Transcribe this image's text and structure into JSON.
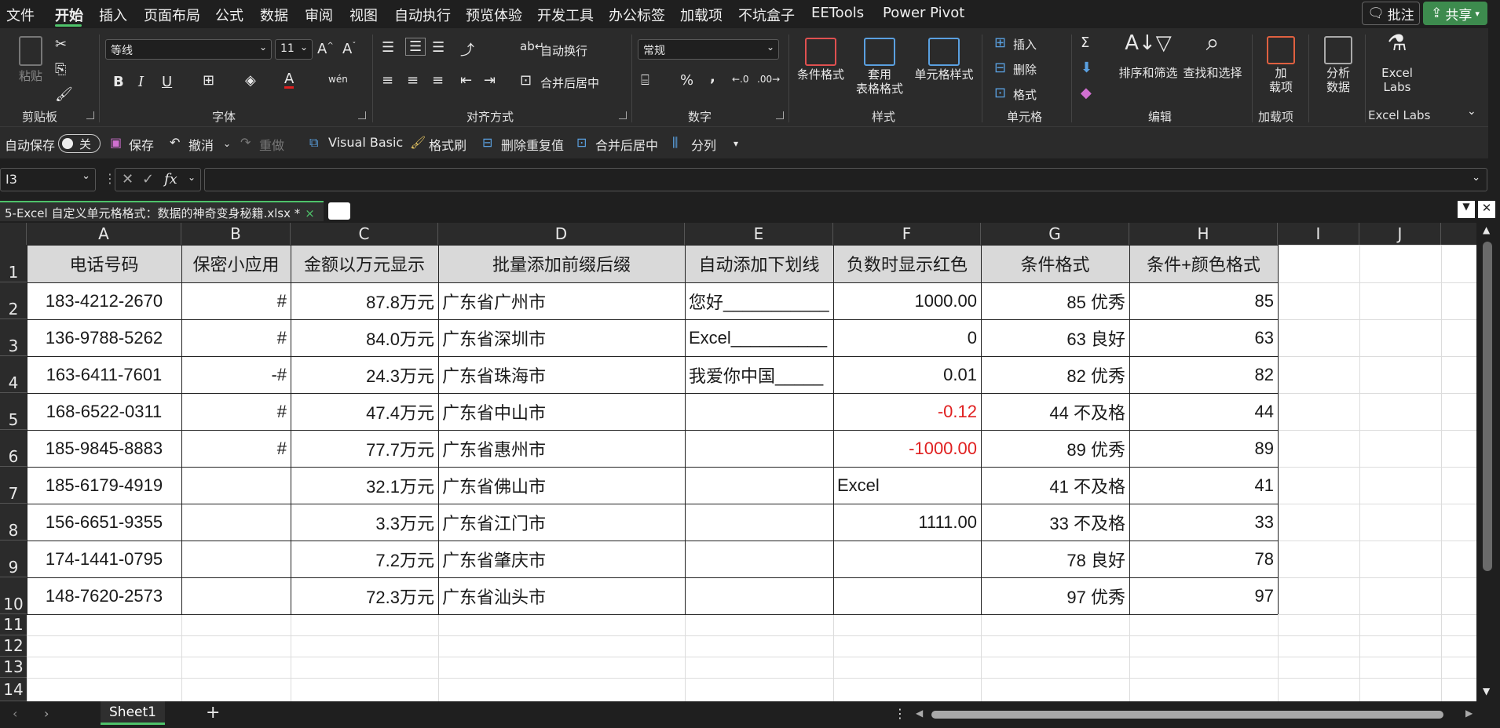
{
  "menu": {
    "file": "文件",
    "home": "开始",
    "insert": "插入",
    "layout": "页面布局",
    "formula": "公式",
    "data": "数据",
    "review": "审阅",
    "view": "视图",
    "automate": "自动执行",
    "preview": "预览体验",
    "developer": "开发工具",
    "office_tab": "办公标签",
    "addins": "加载项",
    "buxbox": "不坑盒子",
    "eetools": "EETools",
    "powerpivot": "Power Pivot"
  },
  "top_buttons": {
    "comment": "批注",
    "share": "共享"
  },
  "ribbon": {
    "clipboard": {
      "label": "剪贴板",
      "paste": "粘贴"
    },
    "font": {
      "label": "字体",
      "name": "等线",
      "size": "11",
      "bold": "B",
      "italic": "I",
      "underline": "U"
    },
    "align": {
      "label": "对齐方式",
      "wrap": "自动换行",
      "merge": "合并后居中"
    },
    "number": {
      "label": "数字",
      "format": "常规",
      "percent": "%",
      "comma": ","
    },
    "styles": {
      "label": "样式",
      "cond": "条件格式",
      "table_l1": "套用",
      "table_l2": "表格格式",
      "cellstyle": "单元格样式"
    },
    "cells": {
      "label": "单元格",
      "insert": "插入",
      "delete": "删除",
      "format": "格式"
    },
    "edit": {
      "label": "编辑",
      "sort": "排序和筛选",
      "find": "查找和选择"
    },
    "addins": {
      "label": "加载项",
      "btn_l1": "加",
      "btn_l2": "载项"
    },
    "analyze": {
      "l1": "分析",
      "l2": "数据"
    },
    "excellabs": {
      "label": "Excel Labs",
      "l1": "Excel",
      "l2": "Labs"
    }
  },
  "qat": {
    "autosave": "自动保存",
    "toggle": "关",
    "save": "保存",
    "undo": "撤消",
    "redo": "重做",
    "vb": "Visual Basic",
    "painter": "格式刷",
    "dedupe": "删除重复值",
    "merge": "合并后居中",
    "split": "分列"
  },
  "formula": {
    "namebox": "I3",
    "fx": "fx",
    "content": ""
  },
  "doc_tab": {
    "title": "5-Excel 自定义单元格格式：数据的神奇变身秘籍.xlsx *"
  },
  "columns": [
    "A",
    "B",
    "C",
    "D",
    "E",
    "F",
    "G",
    "H",
    "I",
    "J"
  ],
  "rows": [
    "1",
    "2",
    "3",
    "4",
    "5",
    "6",
    "7",
    "8",
    "9",
    "10",
    "11",
    "12",
    "13",
    "14"
  ],
  "headers": [
    "电话号码",
    "保密小应用",
    "金额以万元显示",
    "批量添加前缀后缀",
    "自动添加下划线",
    "负数时显示红色",
    "条件格式",
    "条件+颜色格式"
  ],
  "table": [
    [
      "183-4212-2670",
      "#",
      "87.8万元",
      "广东省广州市",
      "您好___________",
      "1000.00",
      "85 优秀",
      "85"
    ],
    [
      "136-9788-5262",
      "#",
      "84.0万元",
      "广东省深圳市",
      "Excel__________",
      "0",
      "63 良好",
      "63"
    ],
    [
      "163-6411-7601",
      "-#",
      "24.3万元",
      "广东省珠海市",
      "我爱你中国_____",
      "0.01",
      "82 优秀",
      "82"
    ],
    [
      "168-6522-0311",
      "#",
      "47.4万元",
      "广东省中山市",
      "",
      "-0.12",
      "44 不及格",
      "44"
    ],
    [
      "185-9845-8883",
      "#",
      "77.7万元",
      "广东省惠州市",
      "",
      "-1000.00",
      "89 优秀",
      "89"
    ],
    [
      "185-6179-4919",
      "",
      "32.1万元",
      "广东省佛山市",
      "",
      "Excel",
      "41 不及格",
      "41"
    ],
    [
      "156-6651-9355",
      "",
      "3.3万元",
      "广东省江门市",
      "",
      "1111.00",
      "33 不及格",
      "33"
    ],
    [
      "174-1441-0795",
      "",
      "7.2万元",
      "广东省肇庆市",
      "",
      "",
      "78 良好",
      "78"
    ],
    [
      "148-7620-2573",
      "",
      "72.3万元",
      "广东省汕头市",
      "",
      "",
      "97 优秀",
      "97"
    ]
  ],
  "sheet_tab": "Sheet1",
  "colors": {
    "accent": "#4ec26a",
    "red": "#e02020",
    "header_fill": "#d9d9d9"
  }
}
